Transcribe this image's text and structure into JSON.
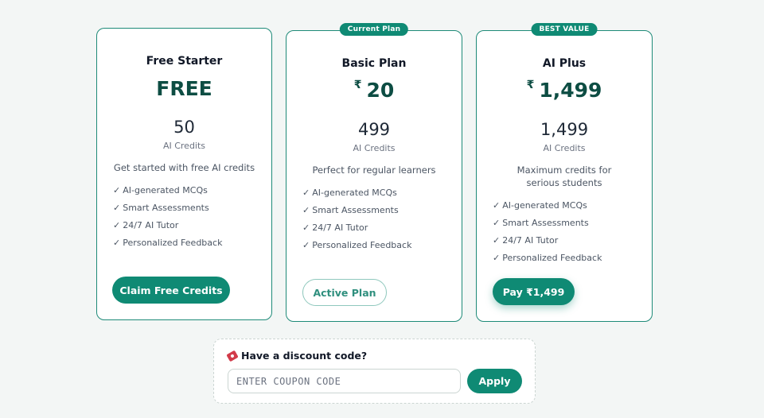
{
  "plans": [
    {
      "name": "Free Starter",
      "price": "FREE",
      "currency": "",
      "credits": "50",
      "credits_label": "AI Credits",
      "description": "Get started with free AI credits",
      "features": [
        "AI-generated MCQs",
        "Smart Assessments",
        "24/7 AI Tutor",
        "Personalized Feedback"
      ],
      "button_label": "Claim Free Credits"
    },
    {
      "ribbon": "Current Plan",
      "name": "Basic Plan",
      "price": "20",
      "currency": "₹",
      "credits": "499",
      "credits_label": "AI Credits",
      "description": "Perfect for regular learners",
      "features": [
        "AI-generated MCQs",
        "Smart Assessments",
        "24/7 AI Tutor",
        "Personalized Feedback"
      ],
      "button_label": "Active Plan"
    },
    {
      "ribbon": "BEST VALUE",
      "name": "AI Plus",
      "price": "1,499",
      "currency": "₹",
      "credits": "1,499",
      "credits_label": "AI Credits",
      "description": "Maximum credits for serious students",
      "features": [
        "AI-generated MCQs",
        "Smart Assessments",
        "24/7 AI Tutor",
        "Personalized Feedback"
      ],
      "button_label": "Pay ₹1,499"
    }
  ],
  "check_glyph": "✓",
  "discount": {
    "title": "Have a discount code?",
    "icon": "ticket-icon",
    "placeholder": "ENTER COUPON CODE",
    "value": "",
    "apply_label": "Apply"
  },
  "colors": {
    "accent": "#0f8a74",
    "price_text": "#0d4d43",
    "card_border": "#1e8a78",
    "background": "#f3f6f5",
    "ticket_icon": "#d23b4a"
  }
}
